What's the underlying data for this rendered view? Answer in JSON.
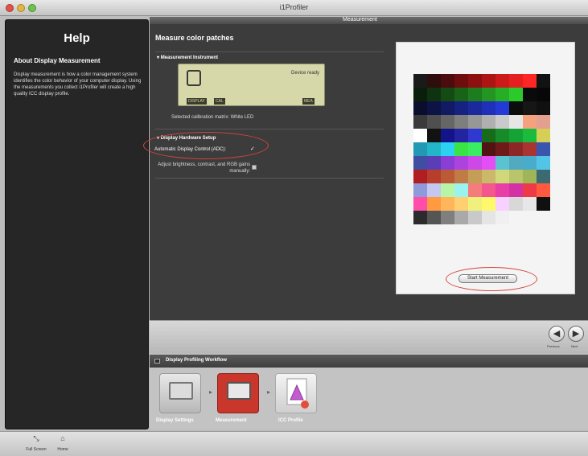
{
  "window": {
    "title": "i1Profiler"
  },
  "help": {
    "title": "Help",
    "heading": "About Display Measurement",
    "body": "Display measurement is how a color management system identifies the color behavior of your computer display. Using the measurements you collect i1Profiler will create a high quality ICC display profile."
  },
  "main": {
    "header_label": "Measurement",
    "section_title": "Measure color patches",
    "instrument": {
      "heading": "Measurement Instrument",
      "status": "Device ready",
      "tags": [
        "DISPLAY",
        "CAL",
        "MEA"
      ],
      "calibration_matrix": "Selected calibration matrix: White LED"
    },
    "hardware": {
      "heading": "Display Hardware Setup",
      "adc_label": "Automatic Display Control (ADC):",
      "adc_checked": "✓",
      "manual_label": "Adjust brightness, contrast, and RGB gains manually:"
    },
    "start_button": "Start Measurement",
    "patches": [
      [
        "#1a1a1a",
        "#2e0d0d",
        "#4a0c0c",
        "#6e0d0d",
        "#8d0f10",
        "#ad1414",
        "#cb1a1a",
        "#e51f1f",
        "#ff2626",
        "#121212"
      ],
      [
        "#0b1d0b",
        "#0f3310",
        "#144a14",
        "#196319",
        "#1d7c1e",
        "#229522",
        "#26ae27",
        "#2cc92c",
        "#0a0a0a",
        "#070707"
      ],
      [
        "#0b0d2c",
        "#0e1346",
        "#111a63",
        "#15227f",
        "#1a2a9c",
        "#1f31b8",
        "#233ad5",
        "#0c0c0c",
        "#161616",
        "#101010"
      ],
      [
        "#3a3a3a",
        "#4f4f4f",
        "#666666",
        "#7e7e7e",
        "#979797",
        "#b0b0b0",
        "#cacaca",
        "#e6e6e6",
        "#f3a27d",
        "#e3a08e"
      ],
      [
        "#ffffff",
        "#121212",
        "#13138a",
        "#23249f",
        "#2f38d0",
        "#166c19",
        "#178a2a",
        "#15a335",
        "#1bbb3d",
        "#d6cf56"
      ],
      [
        "#2299b4",
        "#25b5c8",
        "#2cd2f1",
        "#3be445",
        "#39ef61",
        "#521313",
        "#6e1a1b",
        "#8d2727",
        "#a93431",
        "#3a55ad"
      ],
      [
        "#3f4da2",
        "#5b3db5",
        "#8a3fd4",
        "#ac43df",
        "#cd48e8",
        "#e34ff5",
        "#5bc2d0",
        "#52aac0",
        "#4aaccb",
        "#54c4e6"
      ],
      [
        "#b01e22",
        "#b63e2b",
        "#bb5a36",
        "#c07b46",
        "#c59d56",
        "#cab969",
        "#d1d77b",
        "#b8c56a",
        "#9fb558",
        "#3b6b70"
      ],
      [
        "#8e9ad9",
        "#c4c8f1",
        "#b7f5a9",
        "#9af3ee",
        "#f47c7c",
        "#f4568e",
        "#e73fa5",
        "#d432a4",
        "#ee3a46",
        "#ff5a3f"
      ],
      [
        "#ff4da9",
        "#ff9a41",
        "#ffb55a",
        "#ffd072",
        "#f0f07c",
        "#fff86a",
        "#f9d1ff",
        "#d8d8d8",
        "#e7e7e7",
        "#101010"
      ],
      [
        "#2b2b2b",
        "#555555",
        "#7f7f7f",
        "#a9a9a9",
        "#c9c9c9",
        "#e5e5e5",
        "#f0f0f0"
      ]
    ]
  },
  "nav": {
    "previous_label": "Previous",
    "next_label": "Next",
    "previous_icon": "◀",
    "next_icon": "▶"
  },
  "workflow": {
    "title": "Display Profiling Workflow",
    "items": [
      {
        "label": "Display Settings"
      },
      {
        "label": "Measurement"
      },
      {
        "label": "ICC Profile"
      }
    ]
  },
  "toolbar": {
    "items": [
      {
        "label": "Full Screen",
        "icon": "⤡"
      },
      {
        "label": "Home",
        "icon": "⌂"
      }
    ]
  }
}
